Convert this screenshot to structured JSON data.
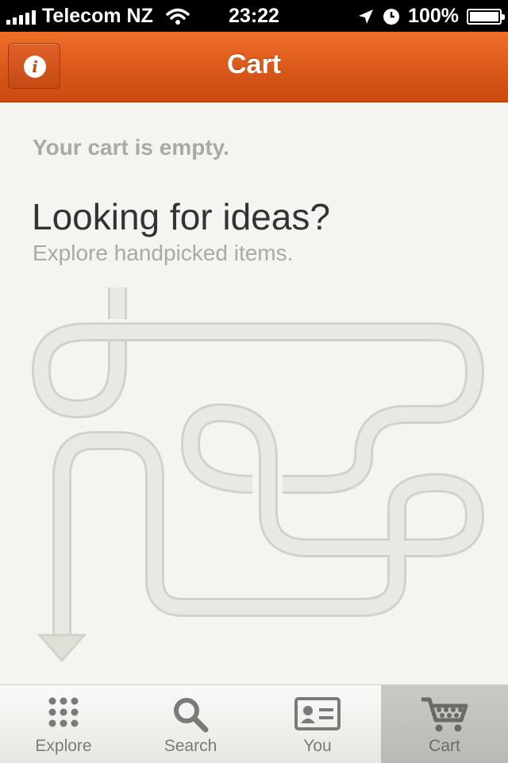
{
  "status_bar": {
    "carrier": "Telecom NZ",
    "time": "23:22",
    "battery": "100%",
    "battery_level": 1.0,
    "icons": [
      "signal-icon",
      "wifi-icon",
      "location-arrow-icon",
      "clock-icon",
      "battery-icon"
    ]
  },
  "nav": {
    "title": "Cart",
    "info_button": "info-icon",
    "colors": {
      "accent": "#d9571a"
    }
  },
  "content": {
    "empty_message": "Your cart is empty.",
    "headline": "Looking for ideas?",
    "subtitle": "Explore handpicked items."
  },
  "tabs": [
    {
      "label": "Explore",
      "icon": "grid-dots-icon",
      "active": false
    },
    {
      "label": "Search",
      "icon": "magnifier-icon",
      "active": false
    },
    {
      "label": "You",
      "icon": "id-card-icon",
      "active": false
    },
    {
      "label": "Cart",
      "icon": "cart-icon",
      "active": true
    }
  ]
}
